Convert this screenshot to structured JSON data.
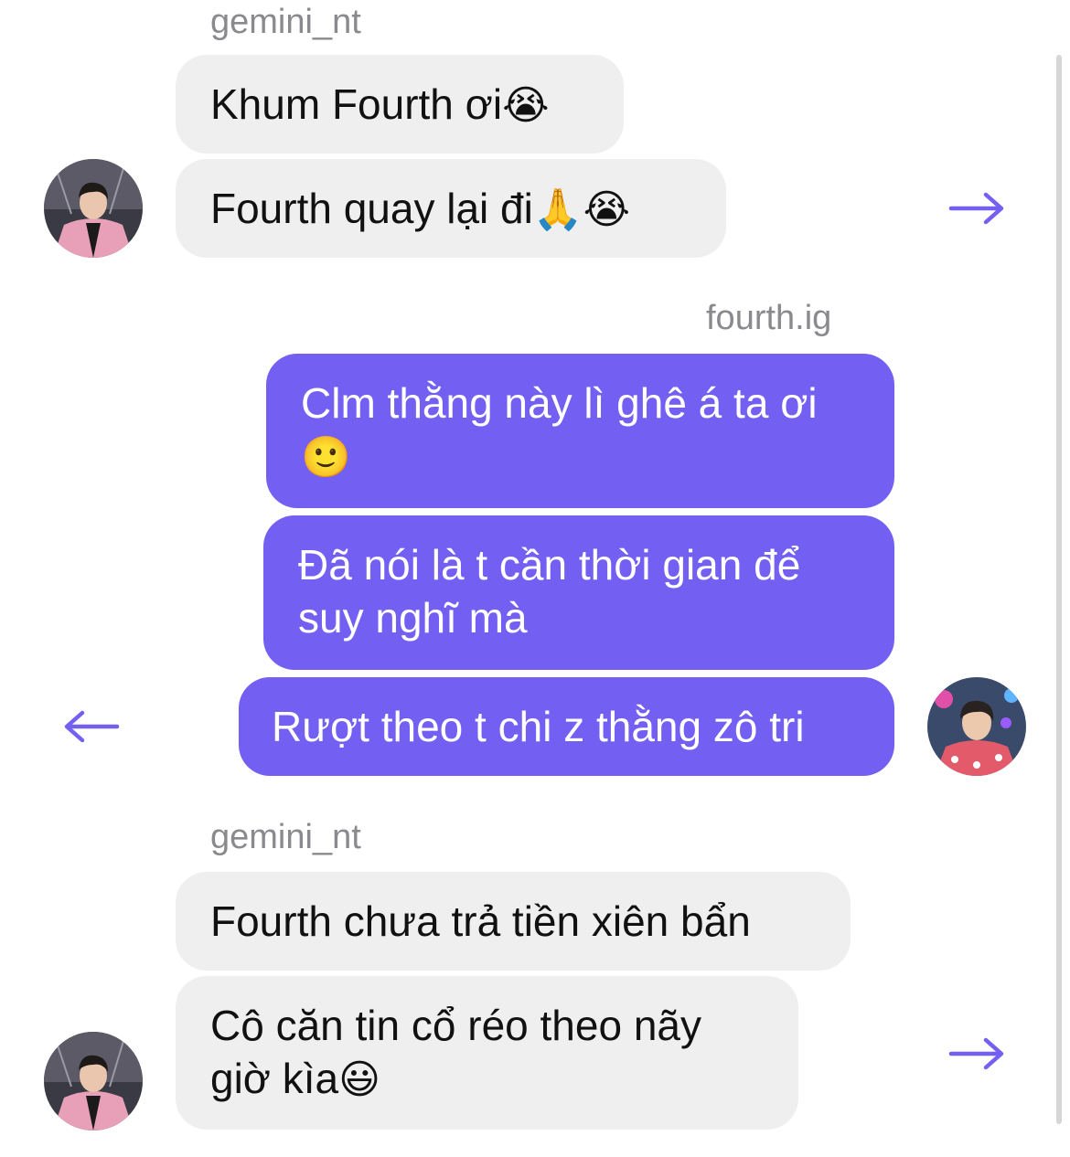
{
  "groups": [
    {
      "sender": "gemini_nt",
      "messages": [
        {
          "text": "Khum Fourth ơi",
          "emoji": "😭"
        },
        {
          "text": "Fourth quay lại đi",
          "emoji": "🙏😭"
        }
      ]
    },
    {
      "sender": "fourth.ig",
      "messages": [
        {
          "text": "Clm thằng này lì ghê á ta ơi",
          "emoji": "🙂"
        },
        {
          "text": "Đã nói là t cần thời gian để suy nghĩ mà",
          "emoji": ""
        },
        {
          "text": "Rượt theo t chi z thằng zô tri",
          "emoji": ""
        }
      ]
    },
    {
      "sender": "gemini_nt",
      "messages": [
        {
          "text": "Fourth chưa trả tiền xiên bẩn",
          "emoji": ""
        },
        {
          "text": "Cô căn tin cổ réo theo nãy giờ kìa",
          "emoji": "😃"
        }
      ]
    }
  ],
  "icons": {
    "forward": "arrow-right-icon",
    "back": "arrow-left-icon"
  },
  "colors": {
    "outgoing_bubble": "#7360f2",
    "incoming_bubble": "#efefef",
    "arrow": "#7360f2",
    "sender_label": "#8a8a8e"
  }
}
